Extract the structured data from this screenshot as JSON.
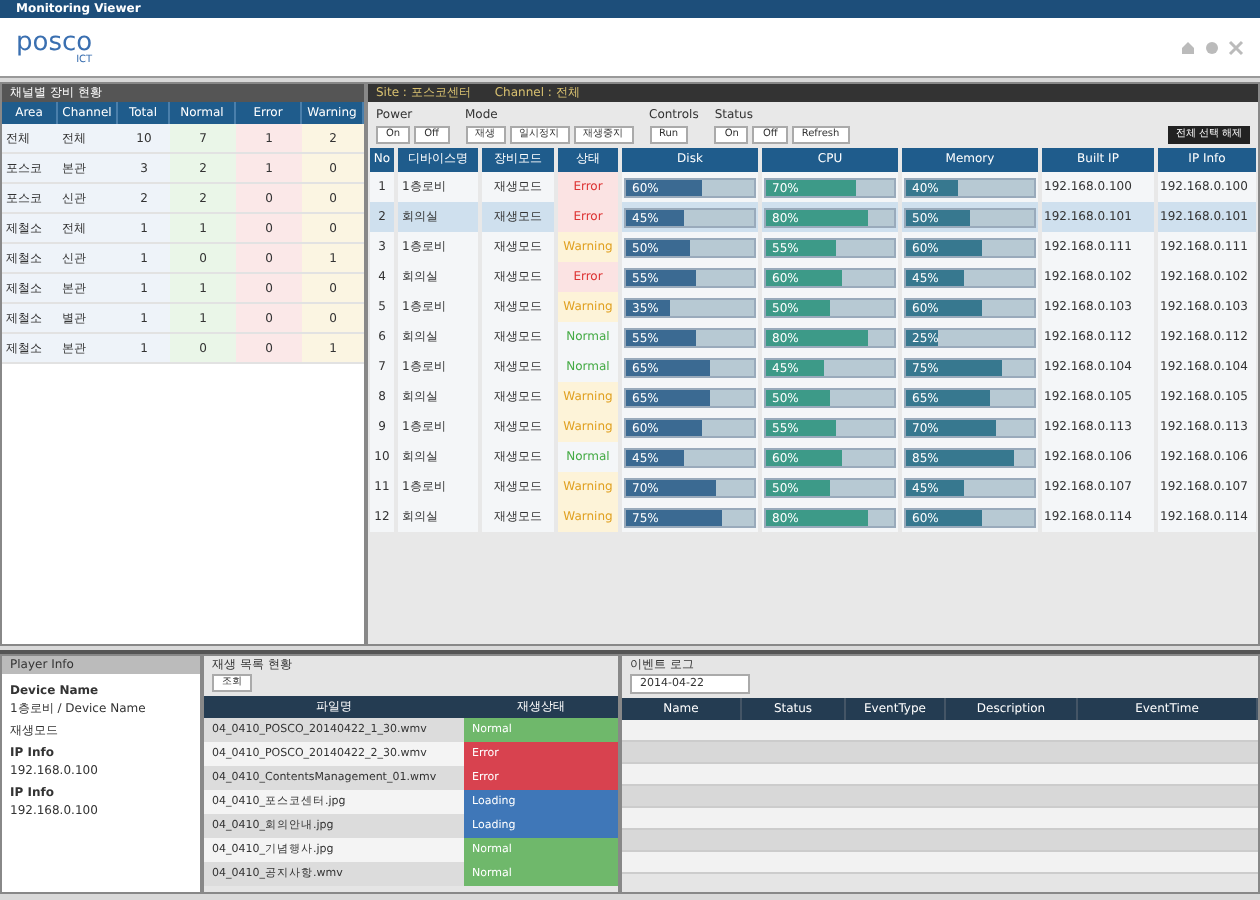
{
  "window": {
    "title": "Monitoring Viewer"
  },
  "logo": {
    "name": "posco",
    "sub": "ICT"
  },
  "area_panel": {
    "title": "채널별 장비 현황",
    "columns": [
      "Area",
      "Channel",
      "Total",
      "Normal",
      "Error",
      "Warning"
    ],
    "rows": [
      [
        "전체",
        "전체",
        "10",
        "7",
        "1",
        "2"
      ],
      [
        "포스코",
        "본관",
        "3",
        "2",
        "1",
        "0"
      ],
      [
        "포스코",
        "신관",
        "2",
        "2",
        "0",
        "0"
      ],
      [
        "제철소",
        "전체",
        "1",
        "1",
        "0",
        "0"
      ],
      [
        "제철소",
        "신관",
        "1",
        "0",
        "0",
        "1"
      ],
      [
        "제철소",
        "본관",
        "1",
        "1",
        "0",
        "0"
      ],
      [
        "제철소",
        "별관",
        "1",
        "1",
        "0",
        "0"
      ],
      [
        "제철소",
        "본관",
        "1",
        "0",
        "0",
        "1"
      ]
    ]
  },
  "device_panel": {
    "title": "Site : 포스코센터",
    "channel": "Channel : 전체",
    "groups": [
      {
        "label": "Power",
        "buttons": [
          "On",
          "Off"
        ]
      },
      {
        "label": "Mode",
        "buttons": [
          "재생",
          "일시정지",
          "재생중지"
        ]
      },
      {
        "label": "Controls",
        "buttons": [
          "Run"
        ]
      },
      {
        "label": "Status",
        "buttons": [
          "On",
          "Off",
          "Refresh"
        ]
      }
    ],
    "action_button": "전체 선택 해제",
    "columns": [
      "No",
      "디바이스명",
      "장비모드",
      "상태",
      "Disk",
      "CPU",
      "Memory",
      "Built IP",
      "IP Info"
    ],
    "rows": [
      {
        "no": "1",
        "name": "1층로비",
        "mode": "재생모드",
        "status": "Error",
        "kind": "error",
        "disk": {
          "level": 0.6,
          "reading": "60%"
        },
        "cpu": {
          "level": 0.7,
          "reading": "70%"
        },
        "memory": {
          "level": 0.4,
          "reading": "40%"
        },
        "built_ip": "192.168.0.100",
        "ip": "192.168.0.100",
        "selected": false
      },
      {
        "no": "2",
        "name": "회의실",
        "mode": "재생모드",
        "status": "Error",
        "kind": "error",
        "disk": {
          "level": 0.45,
          "reading": "45%"
        },
        "cpu": {
          "level": 0.8,
          "reading": "80%"
        },
        "memory": {
          "level": 0.5,
          "reading": "50%"
        },
        "built_ip": "192.168.0.101",
        "ip": "192.168.0.101",
        "selected": true
      },
      {
        "no": "3",
        "name": "1층로비",
        "mode": "재생모드",
        "status": "Warning",
        "kind": "warning",
        "disk": {
          "level": 0.5,
          "reading": "50%"
        },
        "cpu": {
          "level": 0.55,
          "reading": "55%"
        },
        "memory": {
          "level": 0.6,
          "reading": "60%"
        },
        "built_ip": "192.168.0.111",
        "ip": "192.168.0.111",
        "selected": false
      },
      {
        "no": "4",
        "name": "회의실",
        "mode": "재생모드",
        "status": "Error",
        "kind": "error",
        "disk": {
          "level": 0.55,
          "reading": "55%"
        },
        "cpu": {
          "level": 0.6,
          "reading": "60%"
        },
        "memory": {
          "level": 0.45,
          "reading": "45%"
        },
        "built_ip": "192.168.0.102",
        "ip": "192.168.0.102",
        "selected": false
      },
      {
        "no": "5",
        "name": "1층로비",
        "mode": "재생모드",
        "status": "Warning",
        "kind": "warning",
        "disk": {
          "level": 0.35,
          "reading": "35%"
        },
        "cpu": {
          "level": 0.5,
          "reading": "50%"
        },
        "memory": {
          "level": 0.6,
          "reading": "60%"
        },
        "built_ip": "192.168.0.103",
        "ip": "192.168.0.103",
        "selected": false
      },
      {
        "no": "6",
        "name": "회의실",
        "mode": "재생모드",
        "status": "Normal",
        "kind": "normal",
        "disk": {
          "level": 0.55,
          "reading": "55%"
        },
        "cpu": {
          "level": 0.8,
          "reading": "80%"
        },
        "memory": {
          "level": 0.25,
          "reading": "25%"
        },
        "built_ip": "192.168.0.112",
        "ip": "192.168.0.112",
        "selected": false
      },
      {
        "no": "7",
        "name": "1층로비",
        "mode": "재생모드",
        "status": "Normal",
        "kind": "normal",
        "disk": {
          "level": 0.65,
          "reading": "65%"
        },
        "cpu": {
          "level": 0.45,
          "reading": "45%"
        },
        "memory": {
          "level": 0.75,
          "reading": "75%"
        },
        "built_ip": "192.168.0.104",
        "ip": "192.168.0.104",
        "selected": false
      },
      {
        "no": "8",
        "name": "회의실",
        "mode": "재생모드",
        "status": "Warning",
        "kind": "warning",
        "disk": {
          "level": 0.65,
          "reading": "65%"
        },
        "cpu": {
          "level": 0.5,
          "reading": "50%"
        },
        "memory": {
          "level": 0.65,
          "reading": "65%"
        },
        "built_ip": "192.168.0.105",
        "ip": "192.168.0.105",
        "selected": false
      },
      {
        "no": "9",
        "name": "1층로비",
        "mode": "재생모드",
        "status": "Warning",
        "kind": "warning",
        "disk": {
          "level": 0.6,
          "reading": "60%"
        },
        "cpu": {
          "level": 0.55,
          "reading": "55%"
        },
        "memory": {
          "level": 0.7,
          "reading": "70%"
        },
        "built_ip": "192.168.0.113",
        "ip": "192.168.0.113",
        "selected": false
      },
      {
        "no": "10",
        "name": "회의실",
        "mode": "재생모드",
        "status": "Normal",
        "kind": "normal",
        "disk": {
          "level": 0.45,
          "reading": "45%"
        },
        "cpu": {
          "level": 0.6,
          "reading": "60%"
        },
        "memory": {
          "level": 0.85,
          "reading": "85%"
        },
        "built_ip": "192.168.0.106",
        "ip": "192.168.0.106",
        "selected": false
      },
      {
        "no": "11",
        "name": "1층로비",
        "mode": "재생모드",
        "status": "Warning",
        "kind": "warning",
        "disk": {
          "level": 0.7,
          "reading": "70%"
        },
        "cpu": {
          "level": 0.5,
          "reading": "50%"
        },
        "memory": {
          "level": 0.45,
          "reading": "45%"
        },
        "built_ip": "192.168.0.107",
        "ip": "192.168.0.107",
        "selected": false
      },
      {
        "no": "12",
        "name": "회의실",
        "mode": "재생모드",
        "status": "Warning",
        "kind": "warning",
        "disk": {
          "level": 0.75,
          "reading": "75%"
        },
        "cpu": {
          "level": 0.8,
          "reading": "80%"
        },
        "memory": {
          "level": 0.6,
          "reading": "60%"
        },
        "built_ip": "192.168.0.114",
        "ip": "192.168.0.114",
        "selected": false
      }
    ]
  },
  "player_info": {
    "title": "Player Info",
    "fields": [
      {
        "label": "Device Name",
        "value": "1층로비 / Device Name"
      },
      {
        "value": "재생모드"
      },
      {
        "label": "IP Info",
        "value": "192.168.0.100"
      },
      {
        "label": "IP Info",
        "value": "192.168.0.100"
      }
    ]
  },
  "playlist": {
    "title": "재생 목록 현황",
    "button": "조회",
    "columns": [
      "파일명",
      "재생상태"
    ],
    "rows": [
      {
        "file": "04_0410_POSCO_20140422_1_30.wmv",
        "status": "Normal",
        "kind": "normal"
      },
      {
        "file": "04_0410_POSCO_20140422_2_30.wmv",
        "status": "Error",
        "kind": "error"
      },
      {
        "file": "04_0410_ContentsManagement_01.wmv",
        "status": "Error",
        "kind": "error"
      },
      {
        "file": "04_0410_포스코센터.jpg",
        "status": "Loading",
        "kind": "loading"
      },
      {
        "file": "04_0410_회의안내.jpg",
        "status": "Loading",
        "kind": "loading"
      },
      {
        "file": "04_0410_기념행사.jpg",
        "status": "Normal",
        "kind": "normal"
      },
      {
        "file": "04_0410_공지사항.wmv",
        "status": "Normal",
        "kind": "normal"
      }
    ]
  },
  "event_log": {
    "title": "이벤트 로그",
    "date": "2014-04-22",
    "columns": [
      "Name",
      "Status",
      "EventType",
      "Description",
      "EventTime"
    ]
  }
}
